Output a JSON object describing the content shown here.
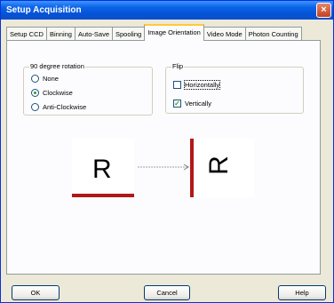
{
  "window": {
    "title": "Setup Acquisition",
    "close_symbol": "×"
  },
  "tabs": [
    {
      "label": "Setup CCD"
    },
    {
      "label": "Binning"
    },
    {
      "label": "Auto-Save"
    },
    {
      "label": "Spooling"
    },
    {
      "label": "Image Orientation",
      "active": true
    },
    {
      "label": "Video Mode"
    },
    {
      "label": "Photon Counting"
    }
  ],
  "rotation": {
    "title": "90 degree rotation",
    "options": [
      {
        "label": "None",
        "selected": false
      },
      {
        "label": "Clockwise",
        "selected": true
      },
      {
        "label": "Anti-Clockwise",
        "selected": false
      }
    ]
  },
  "flip": {
    "title": "Flip",
    "options": [
      {
        "label": "Horizontally",
        "checked": false
      },
      {
        "label": "Vertically",
        "checked": true
      }
    ]
  },
  "preview": {
    "source_letter": "R",
    "result_letter": "R",
    "accent_color": "#b01818",
    "arrow_color": "#a0a0a0"
  },
  "buttons": {
    "ok": "OK",
    "cancel": "Cancel",
    "help": "Help"
  }
}
